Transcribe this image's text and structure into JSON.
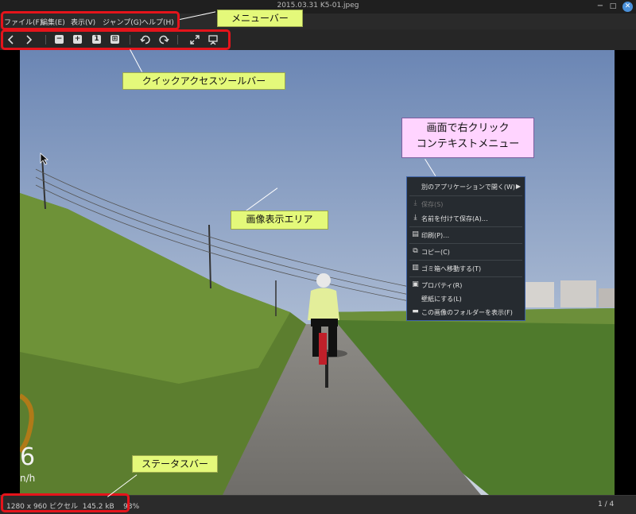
{
  "window": {
    "title": "2015.03.31 K5-01.jpeg",
    "minimize_glyph": "−",
    "maximize_glyph": "□",
    "close_glyph": "✕"
  },
  "menubar": {
    "items": [
      "ファイル(F)",
      "編集(E)",
      "表示(V)",
      "ジャンプ(G)",
      "ヘルプ(H)"
    ]
  },
  "toolbar": {
    "icons": [
      "back-icon",
      "forward-icon",
      "zoom-out-icon",
      "zoom-in-icon",
      "zoom-original-icon",
      "zoom-fit-icon",
      "rotate-left-icon",
      "rotate-right-icon",
      "fullscreen-icon",
      "slideshow-icon"
    ],
    "zoom_original_label": "1"
  },
  "photo": {
    "overlay_speed_digit": "6",
    "overlay_speed_unit": "n/h"
  },
  "context_menu": {
    "items": [
      {
        "label": "別のアプリケーションで開く(W)",
        "icon": "",
        "disabled": false,
        "submenu": true
      },
      {
        "label": "保存(S)",
        "icon": "save-icon",
        "disabled": true
      },
      {
        "label": "名前を付けて保存(A)…",
        "icon": "save-as-icon",
        "disabled": false
      },
      {
        "label": "印刷(P)…",
        "icon": "print-icon",
        "disabled": false
      },
      {
        "label": "コピー(C)",
        "icon": "copy-icon",
        "disabled": false
      },
      {
        "label": "ゴミ箱へ移動する(T)",
        "icon": "trash-icon",
        "disabled": false
      },
      {
        "label": "プロパティ(R)",
        "icon": "properties-icon",
        "disabled": false
      },
      {
        "label": "壁紙にする(L)",
        "icon": "",
        "disabled": false
      },
      {
        "label": "この画像のフォルダーを表示(F)",
        "icon": "folder-icon",
        "disabled": false
      }
    ]
  },
  "statusbar": {
    "info": "1280 x 960 ピクセル  145.2 kB    93%",
    "position": "1 / 4"
  },
  "annotations": {
    "menubar": "メニューバー",
    "toolbar": "クイックアクセスツールバー",
    "image_area": "画像表示エリア",
    "context_menu_line1": "画面で右クリック",
    "context_menu_line2": "コンテキストメニュー",
    "statusbar": "ステータスバー"
  },
  "colors": {
    "annotation_red": "#e5141b",
    "callout_yellow": "#e4f97a",
    "callout_pink": "#ffd4ff",
    "close_button_blue": "#4a90d9"
  }
}
